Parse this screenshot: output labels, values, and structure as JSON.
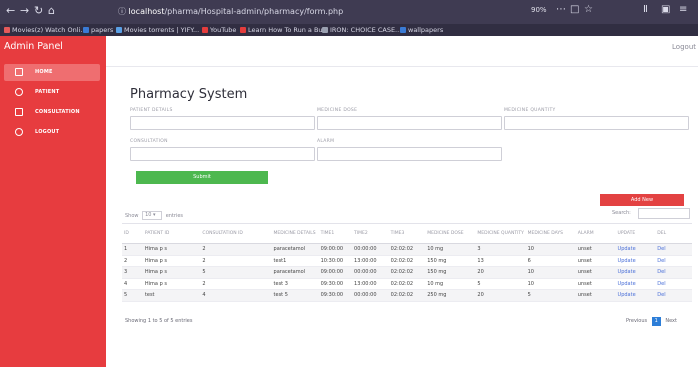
{
  "browser": {
    "url_host": "localhost",
    "url_path": "/pharma/Hospital-admin/pharmacy/form.php",
    "zoom": "90%",
    "bookmarks": [
      {
        "label": "Movies(z) Watch Onli...",
        "color": "#e45a5a"
      },
      {
        "label": "papers",
        "color": "#3a7bd5"
      },
      {
        "label": "Movies torrents | YIFY...",
        "color": "#5aa0e6"
      },
      {
        "label": "YouTube",
        "color": "#e43c3c"
      },
      {
        "label": "Learn How To Run a Bu...",
        "color": "#e43c3c"
      },
      {
        "label": "IRON: CHOICE CASE...",
        "color": "#9aa0b0"
      },
      {
        "label": "wallpapers",
        "color": "#3a7bd5"
      }
    ]
  },
  "sidebar": {
    "title": "Admin Panel",
    "items": [
      {
        "label": "HOME",
        "icon": "home-icon",
        "active": true
      },
      {
        "label": "PATIENT",
        "icon": "patient-icon",
        "active": false
      },
      {
        "label": "CONSULTATION",
        "icon": "consultation-icon",
        "active": false
      },
      {
        "label": "LOGOUT",
        "icon": "logout-icon",
        "active": false
      }
    ]
  },
  "topbar": {
    "logout": "Logout"
  },
  "page": {
    "title": "Pharmacy System"
  },
  "form": {
    "labels": {
      "patient_id": "PATIENT DETAILS",
      "medicine_dose": "MEDICINE DOSE",
      "medicine_quantity": "MEDICINE QUANTITY",
      "consultation_id": "CONSULTATION",
      "alarm": "ALARM"
    },
    "submit": "Submit",
    "add_new": "Add New"
  },
  "table_controls": {
    "show": "Show",
    "entries_value": "10",
    "entries": "entries",
    "search": "Search:"
  },
  "table": {
    "headers": [
      "ID",
      "PATIENT ID",
      "CONSULTATION ID",
      "MEDICINE DETAILS",
      "TIME1",
      "TIME2",
      "TIME3",
      "MEDICINE DOSE",
      "MEDICINE QUANTITY",
      "MEDICINE DAYS",
      "ALARM",
      "UPDATE",
      "DEL"
    ],
    "rows": [
      [
        "1",
        "Hima p s",
        "2",
        "paracetamol",
        "09:00:00",
        "00:00:00",
        "02:02:02",
        "10 mg",
        "3",
        "10",
        "unset",
        "Update",
        "Del"
      ],
      [
        "2",
        "Hima p s",
        "2",
        "test1",
        "10:30:00",
        "13:00:00",
        "02:02:02",
        "150 mg",
        "13",
        "6",
        "unset",
        "Update",
        "Del"
      ],
      [
        "3",
        "Hima p s",
        "5",
        "paracetamol",
        "09:00:00",
        "00:00:00",
        "02:02:02",
        "150 mg",
        "20",
        "10",
        "unset",
        "Update",
        "Del"
      ],
      [
        "4",
        "Hima p s",
        "2",
        "test 3",
        "09:30:00",
        "13:00:00",
        "02:02:02",
        "10 mg",
        "5",
        "10",
        "unset",
        "Update",
        "Del"
      ],
      [
        "5",
        "test",
        "4",
        "test 5",
        "09:30:00",
        "00:00:00",
        "02:02:02",
        "250 mg",
        "20",
        "5",
        "unset",
        "Update",
        "Del"
      ]
    ]
  },
  "pagination": {
    "info": "Showing 1 to 5 of 5 entries",
    "previous": "Previous",
    "current": "1",
    "next": "Next"
  }
}
